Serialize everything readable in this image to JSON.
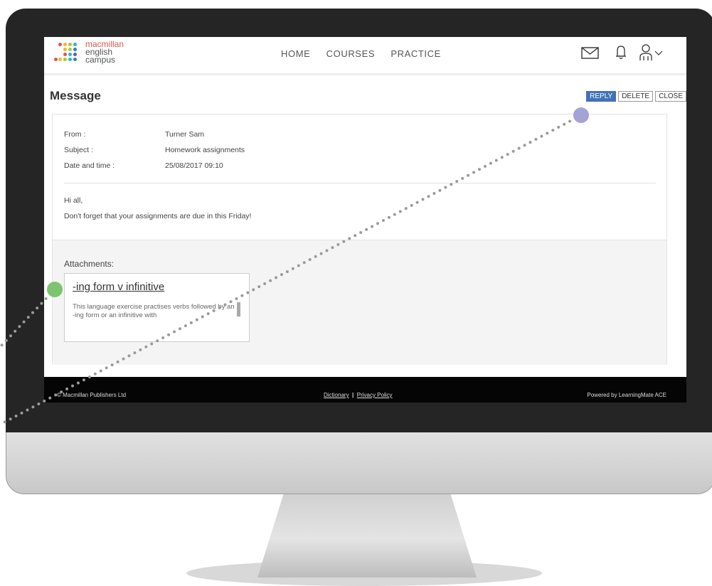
{
  "logo": {
    "line1": "macmillan",
    "line2": "english",
    "line3": "campus"
  },
  "nav": {
    "home": "HOME",
    "courses": "COURSES",
    "practice": "PRACTICE"
  },
  "page": {
    "title": "Message"
  },
  "actions": {
    "reply": "REPLY",
    "delete": "DELETE",
    "close": "CLOSE"
  },
  "message": {
    "from_label": "From :",
    "from": "Turner Sam",
    "subject_label": "Subject :",
    "subject": "Homework assignments",
    "date_label": "Date and time :",
    "date": "25/08/2017 09:10",
    "greeting": "Hi all,",
    "body": "Don't forget that your assignments are due in this Friday!"
  },
  "attachments": {
    "label": "Attachments:",
    "items": [
      {
        "title": "-ing form v infinitive",
        "description": "This language exercise practises verbs followed by an -ing form or an infinitive with"
      }
    ]
  },
  "footer": {
    "copyright": "© Macmillan Publishers Ltd",
    "dictionary": "Dictionary",
    "separator": "|",
    "privacy": "Privacy Policy",
    "powered": "Powered by LearningMate ACE"
  },
  "icons": {
    "mail": "mail-icon",
    "bell": "bell-icon",
    "user": "user-menu-icon"
  },
  "colors": {
    "reply_button": "#4272b8",
    "callout_green": "#7cc46f",
    "callout_purple": "#a4a3d6"
  }
}
